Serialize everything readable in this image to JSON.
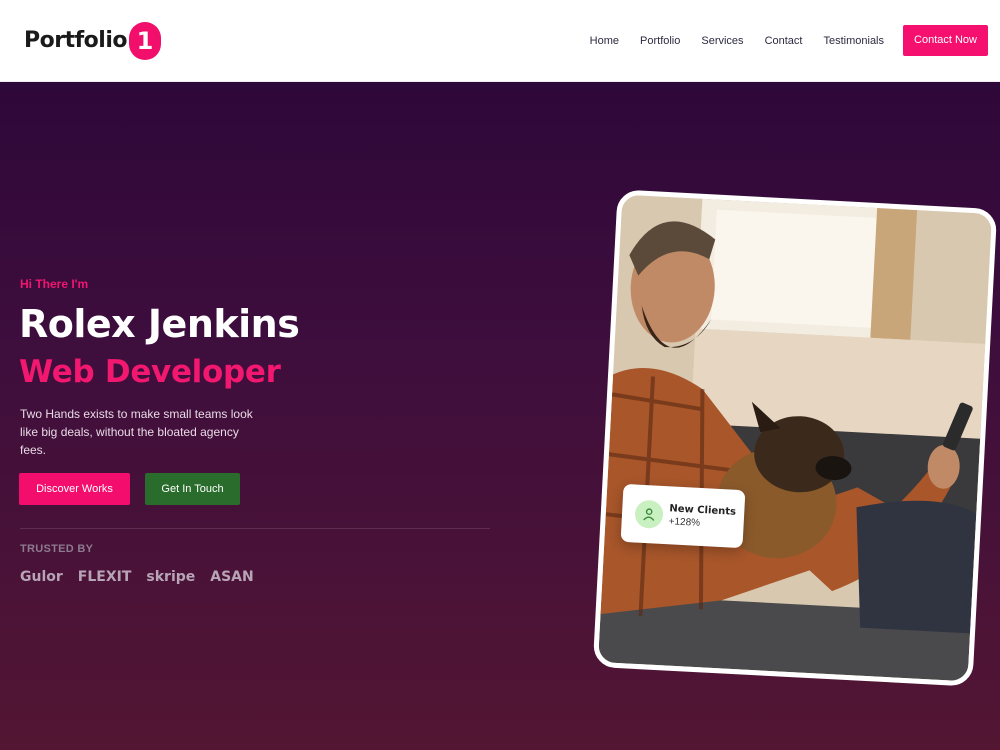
{
  "header": {
    "logo_text": "Portfolio",
    "logo_badge": "1",
    "nav": [
      "Home",
      "Portfolio",
      "Services",
      "Contact",
      "Testimonials"
    ],
    "cta_label": "Contact Now"
  },
  "hero": {
    "greeting": "Hi There I'm",
    "name": "Rolex Jenkins",
    "role": "Web Developer",
    "description": "Two Hands exists to make small teams look like big deals, without the bloated agency fees.",
    "primary_button": "Discover Works",
    "secondary_button": "Get In Touch",
    "trusted_label": "TRUSTED BY",
    "brands": [
      "Gulor",
      "FLEXIT",
      "skripe",
      "ASAN"
    ]
  },
  "stats_badge": {
    "title": "New Clients",
    "value": "+128%",
    "icon": "user-icon"
  },
  "colors": {
    "accent": "#f20f6b",
    "secondary_button": "#2a6c2b",
    "hero_bg_top": "#2e0839",
    "hero_bg_bottom": "#531633"
  }
}
